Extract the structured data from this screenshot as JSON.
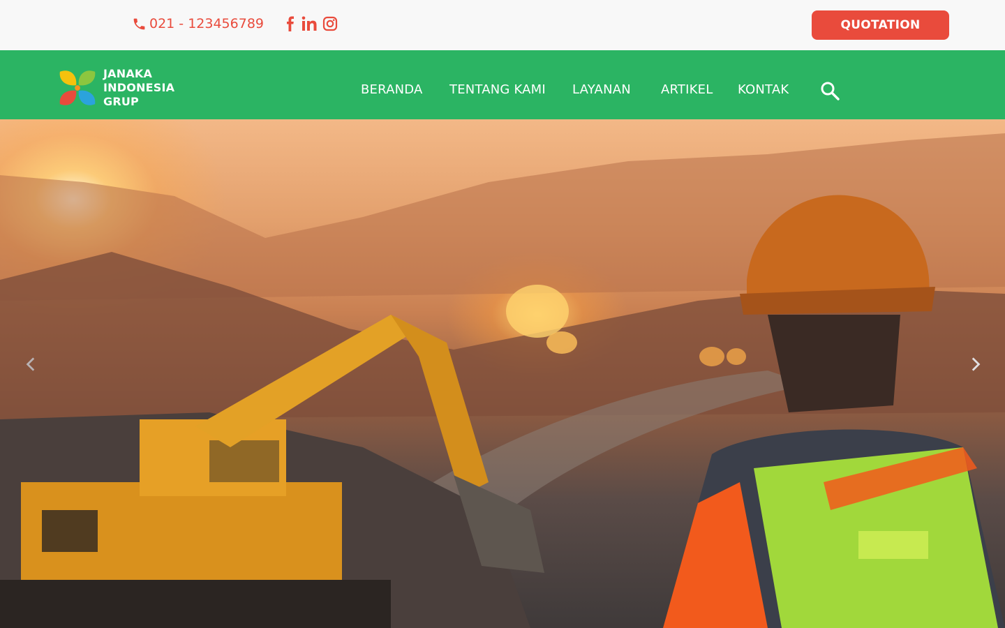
{
  "topbar": {
    "phone": "021 - 123456789",
    "social_icons": [
      "facebook-icon",
      "linkedin-icon",
      "instagram-icon"
    ],
    "quotation_label": "QUOTATION"
  },
  "brand": {
    "line1": "JANAKA",
    "line2": "INDONESIA",
    "line3": "GRUP"
  },
  "nav": {
    "items": [
      "BERANDA",
      "TENTANG KAMI",
      "LAYANAN",
      "ARTIKEL",
      "KONTAK"
    ],
    "search_icon": "search-icon"
  },
  "hero": {
    "description_icons": [
      "chevron-left-icon",
      "chevron-right-icon"
    ]
  },
  "colors": {
    "accent_red": "#e94b3c",
    "nav_green": "#2bb463",
    "topbar_bg": "#f8f8f8"
  }
}
